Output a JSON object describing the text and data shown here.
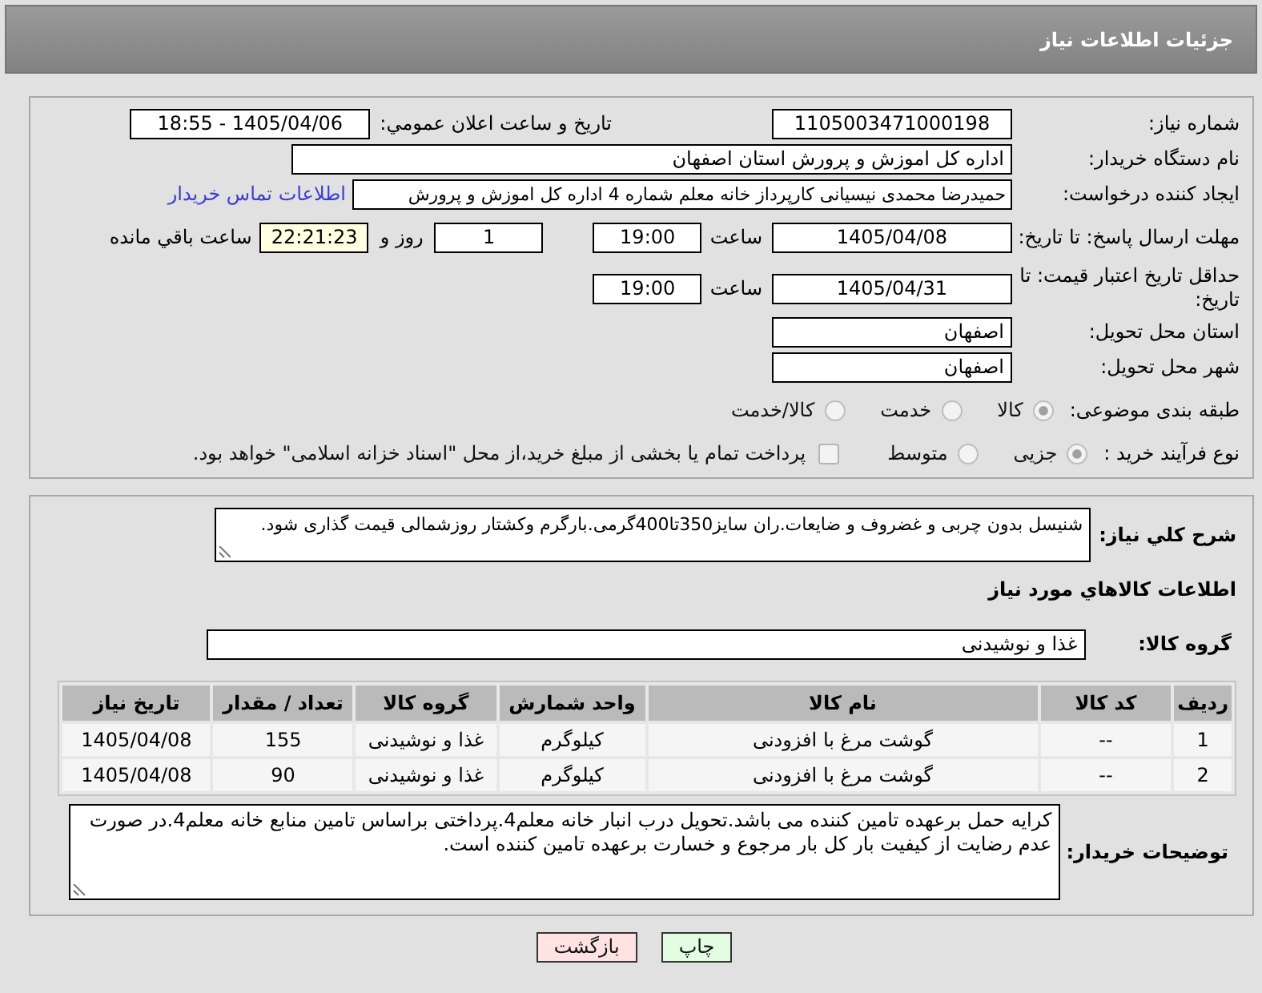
{
  "header": {
    "title": "جزئیات اطلاعات نیاز"
  },
  "need_number": {
    "label": "شماره نیاز:",
    "value": "1105003471000198"
  },
  "announcement": {
    "label": "تاریخ و ساعت اعلان عمومي:",
    "value": "1405/04/06 - 18:55"
  },
  "buyer_org": {
    "label": "نام دستگاه خریدار:",
    "value": "اداره کل اموزش و پرورش استان اصفهان"
  },
  "requester": {
    "label": "ایجاد کننده درخواست:",
    "value": "حمیدرضا محمدی نیسیانی کارپرداز خانه معلم شماره 4 اداره کل اموزش و پرورش",
    "contact_link": "اطلاعات تماس خریدار"
  },
  "response_deadline": {
    "label": "مهلت ارسال پاسخ: تا تاریخ:",
    "date": "1405/04/08",
    "time_label": "ساعت",
    "time": "19:00",
    "days": "1",
    "days_label": "روز و",
    "remaining": "22:21:23",
    "remaining_label": "ساعت باقي مانده"
  },
  "price_validity": {
    "label": "حداقل تاریخ اعتبار قیمت: تا تاریخ:",
    "date": "1405/04/31",
    "time_label": "ساعت",
    "time": "19:00"
  },
  "delivery_province": {
    "label": "استان محل تحویل:",
    "value": "اصفهان"
  },
  "delivery_city": {
    "label": "شهر محل تحویل:",
    "value": "اصفهان"
  },
  "category": {
    "label": "طبقه بندی موضوعی:",
    "options": [
      {
        "label": "کالا",
        "selected": true
      },
      {
        "label": "خدمت",
        "selected": false
      },
      {
        "label": "کالا/خدمت",
        "selected": false
      }
    ]
  },
  "purchase_process": {
    "label": "نوع فرآیند خرید :",
    "options": [
      {
        "label": "جزیی",
        "selected": true
      },
      {
        "label": "متوسط",
        "selected": false
      }
    ],
    "treasury": {
      "label": "پرداخت تمام یا بخشی از مبلغ خرید،از محل \"اسناد خزانه اسلامی\" خواهد بود.",
      "checked": false
    }
  },
  "description": {
    "label": "شرح کلي نیاز:",
    "value": "شنیسل بدون چربی و غضروف و ضایعات.ران سایز350تا400گرمی.بارگرم وکشتار روزشمالی قیمت گذاری شود."
  },
  "goods_heading": "اطلاعات کالاهاي مورد نیاز",
  "goods_group": {
    "label": "گروه کالا:",
    "value": "غذا و نوشیدنی"
  },
  "table": {
    "columns": [
      "ردیف",
      "کد کالا",
      "نام کالا",
      "واحد شمارش",
      "گروه کالا",
      "تعداد / مقدار",
      "تاریخ نیاز"
    ],
    "rows": [
      [
        "1",
        "--",
        "گوشت مرغ با افزودنی",
        "کیلوگرم",
        "غذا و نوشیدنی",
        "155",
        "1405/04/08"
      ],
      [
        "2",
        "--",
        "گوشت مرغ با افزودنی",
        "کیلوگرم",
        "غذا و نوشیدنی",
        "90",
        "1405/04/08"
      ]
    ]
  },
  "buyer_notes": {
    "label": "توضیحات خریدار:",
    "value": "کرایه حمل برعهده تامین کننده می باشد.تحویل درب انبار خانه معلم4.پرداختی براساس تامین منابع خانه معلم4.در صورت عدم رضایت از کیفیت بار کل بار مرجوع و خسارت برعهده تامین کننده است."
  },
  "buttons": [
    {
      "label": "چاپ",
      "kind": "print"
    },
    {
      "label": "بازگشت",
      "kind": "back"
    }
  ]
}
